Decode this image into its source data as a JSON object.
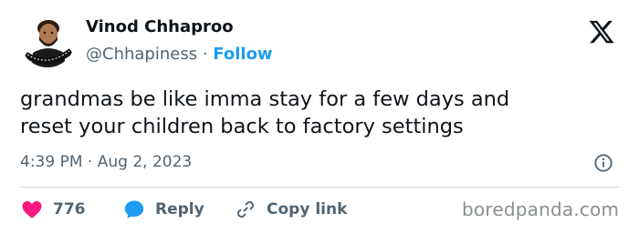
{
  "author": {
    "name": "Vinod Chhaproo",
    "handle": "@Chhapiness",
    "separator": "·",
    "follow_label": "Follow"
  },
  "tweet": {
    "line1": "grandmas be like imma stay for a few days and",
    "line2": "reset your children back to factory settings",
    "time": "4:39 PM",
    "date_separator": "·",
    "date": "Aug 2, 2023"
  },
  "actions": {
    "likes_count": "776",
    "reply_label": "Reply",
    "copy_label": "Copy link"
  },
  "icons": {
    "platform": "x-logo-icon",
    "info": "info-icon",
    "like": "heart-icon",
    "reply": "reply-bubble-icon",
    "copy": "link-icon"
  },
  "colors": {
    "follow": "#1d9bf0",
    "heart": "#f91880",
    "reply_bubble": "#1d9bf0",
    "secondary_text": "#536471"
  },
  "watermark": "boredpanda.com"
}
